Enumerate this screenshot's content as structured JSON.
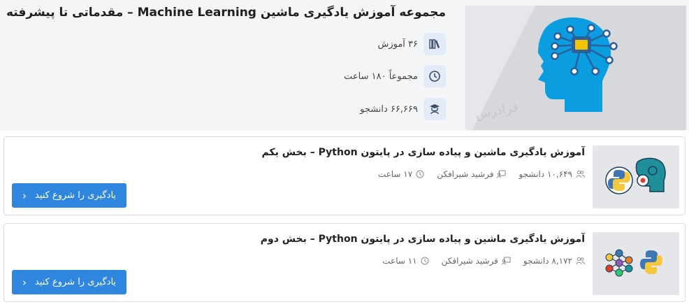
{
  "collection": {
    "title": "مجموعه آموزش یادگیری ماشین Machine Learning – مقدماتی تا پیشرفته",
    "stats": {
      "courses": "۳۶ آموزش",
      "duration": "مجموعاً ۱۸۰ ساعت",
      "students": "۶۶,۶۶۹ دانشجو"
    },
    "watermark": "فرادرس"
  },
  "courses": [
    {
      "title": "آموزش یادگیری ماشین و پیاده سازی در پایتون Python – بخش یکم",
      "students": "۱۰,۶۴۹ دانشجو",
      "instructor": "فرشید شیرافکن",
      "duration": "۱۷ ساعت",
      "cta": "یادگیری را شروع کنید"
    },
    {
      "title": "آموزش یادگیری ماشین و پیاده سازی در پایتون Python – بخش دوم",
      "students": "۸,۱۷۲ دانشجو",
      "instructor": "فرشید شیرافکن",
      "duration": "۱۱ ساعت",
      "cta": "یادگیری را شروع کنید"
    }
  ],
  "colors": {
    "accent": "#2e86de",
    "head": "#009cde",
    "chip": "#2c5f9e"
  },
  "icons": [
    "books-icon",
    "clock-icon",
    "graduate-icon",
    "users-icon",
    "instructor-icon",
    "chevron-left-icon"
  ]
}
